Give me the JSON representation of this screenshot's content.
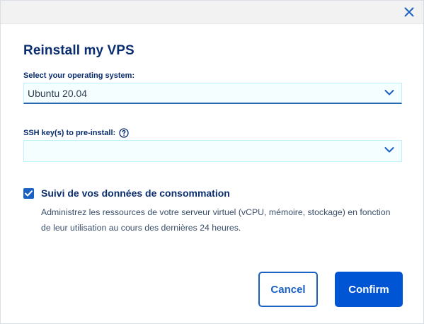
{
  "dialog": {
    "title": "Reinstall my VPS"
  },
  "os_field": {
    "label": "Select your operating system:",
    "value": "Ubuntu 20.04"
  },
  "ssh_field": {
    "label": "SSH key(s) to pre-install:",
    "value": ""
  },
  "monitoring": {
    "checked": true,
    "label": "Suivi de vos données de consommation",
    "description": "Administrez les ressources de votre serveur virtuel (vCPU, mémoire, stockage) en fonction de leur utilisation au cours des dernières 24 heures."
  },
  "actions": {
    "cancel_label": "Cancel",
    "confirm_label": "Confirm"
  },
  "icons": {
    "close": "close-icon",
    "help": "help-circle-icon",
    "dropdown": "chevron-down-icon",
    "check": "checkmark-icon"
  },
  "colors": {
    "primary": "#0055d4",
    "heading": "#0a2d6e",
    "accent": "#1b61c2",
    "field_bg": "#f5feff"
  }
}
